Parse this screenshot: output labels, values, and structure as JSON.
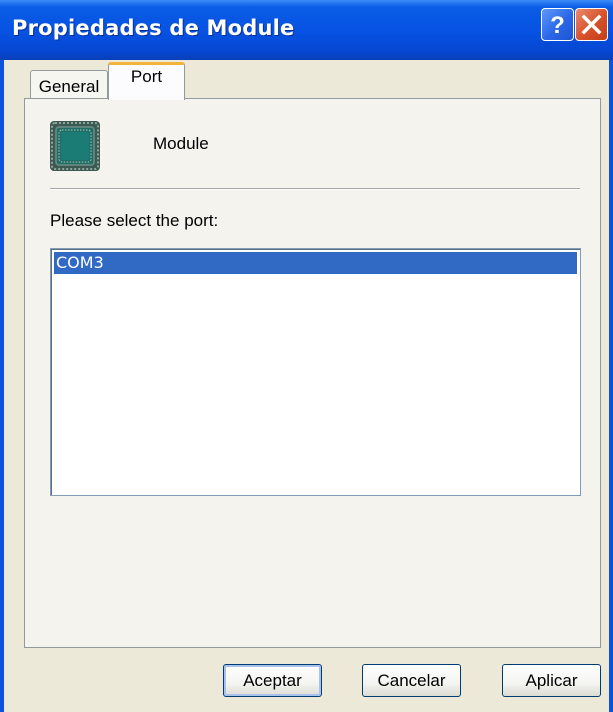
{
  "window": {
    "title": "Propiedades de Module",
    "help_glyph": "?",
    "colors": {
      "titlebar": "#0753e3",
      "selection": "#316ac5",
      "tab_highlight": "#f2b33c",
      "close_button": "#d7502a"
    }
  },
  "tabs": [
    {
      "label": "General",
      "selected": false
    },
    {
      "label": "Port",
      "selected": true
    }
  ],
  "device": {
    "icon": "chip-icon",
    "name": "Module"
  },
  "port_selection": {
    "prompt": "Please select the port:",
    "options": [
      "COM3"
    ],
    "selected": "COM3"
  },
  "buttons": {
    "ok": "Aceptar",
    "cancel": "Cancelar",
    "apply": "Aplicar"
  }
}
